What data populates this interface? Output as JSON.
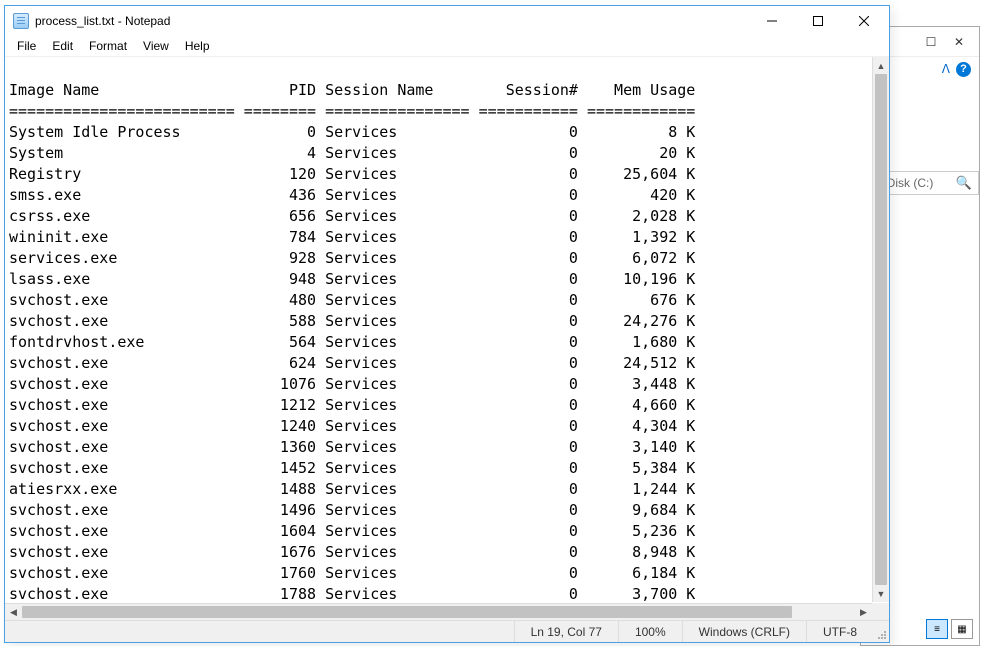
{
  "notepad": {
    "title": "process_list.txt - Notepad",
    "menu": {
      "file": "File",
      "edit": "Edit",
      "format": "Format",
      "view": "View",
      "help": "Help"
    },
    "status": {
      "pos": "Ln 19, Col 77",
      "zoom": "100%",
      "lineend": "Windows (CRLF)",
      "encoding": "UTF-8"
    },
    "header": "Image Name                     PID Session Name        Session#    Mem Usage",
    "separator": "========================= ======== ================ =========== ============",
    "rows": [
      {
        "name": "System Idle Process",
        "pid": "0",
        "session": "Services",
        "snum": "0",
        "mem": "8 K"
      },
      {
        "name": "System",
        "pid": "4",
        "session": "Services",
        "snum": "0",
        "mem": "20 K"
      },
      {
        "name": "Registry",
        "pid": "120",
        "session": "Services",
        "snum": "0",
        "mem": "25,604 K"
      },
      {
        "name": "smss.exe",
        "pid": "436",
        "session": "Services",
        "snum": "0",
        "mem": "420 K"
      },
      {
        "name": "csrss.exe",
        "pid": "656",
        "session": "Services",
        "snum": "0",
        "mem": "2,028 K"
      },
      {
        "name": "wininit.exe",
        "pid": "784",
        "session": "Services",
        "snum": "0",
        "mem": "1,392 K"
      },
      {
        "name": "services.exe",
        "pid": "928",
        "session": "Services",
        "snum": "0",
        "mem": "6,072 K"
      },
      {
        "name": "lsass.exe",
        "pid": "948",
        "session": "Services",
        "snum": "0",
        "mem": "10,196 K"
      },
      {
        "name": "svchost.exe",
        "pid": "480",
        "session": "Services",
        "snum": "0",
        "mem": "676 K"
      },
      {
        "name": "svchost.exe",
        "pid": "588",
        "session": "Services",
        "snum": "0",
        "mem": "24,276 K"
      },
      {
        "name": "fontdrvhost.exe",
        "pid": "564",
        "session": "Services",
        "snum": "0",
        "mem": "1,680 K"
      },
      {
        "name": "svchost.exe",
        "pid": "624",
        "session": "Services",
        "snum": "0",
        "mem": "24,512 K"
      },
      {
        "name": "svchost.exe",
        "pid": "1076",
        "session": "Services",
        "snum": "0",
        "mem": "3,448 K"
      },
      {
        "name": "svchost.exe",
        "pid": "1212",
        "session": "Services",
        "snum": "0",
        "mem": "4,660 K"
      },
      {
        "name": "svchost.exe",
        "pid": "1240",
        "session": "Services",
        "snum": "0",
        "mem": "4,304 K"
      },
      {
        "name": "svchost.exe",
        "pid": "1360",
        "session": "Services",
        "snum": "0",
        "mem": "3,140 K"
      },
      {
        "name": "svchost.exe",
        "pid": "1452",
        "session": "Services",
        "snum": "0",
        "mem": "5,384 K"
      },
      {
        "name": "atiesrxx.exe",
        "pid": "1488",
        "session": "Services",
        "snum": "0",
        "mem": "1,244 K"
      },
      {
        "name": "svchost.exe",
        "pid": "1496",
        "session": "Services",
        "snum": "0",
        "mem": "9,684 K"
      },
      {
        "name": "svchost.exe",
        "pid": "1604",
        "session": "Services",
        "snum": "0",
        "mem": "5,236 K"
      },
      {
        "name": "svchost.exe",
        "pid": "1676",
        "session": "Services",
        "snum": "0",
        "mem": "8,948 K"
      },
      {
        "name": "svchost.exe",
        "pid": "1760",
        "session": "Services",
        "snum": "0",
        "mem": "6,184 K"
      },
      {
        "name": "svchost.exe",
        "pid": "1788",
        "session": "Services",
        "snum": "0",
        "mem": "3,700 K"
      }
    ]
  },
  "explorer": {
    "addr_fragment": "cal Disk (C:)"
  }
}
